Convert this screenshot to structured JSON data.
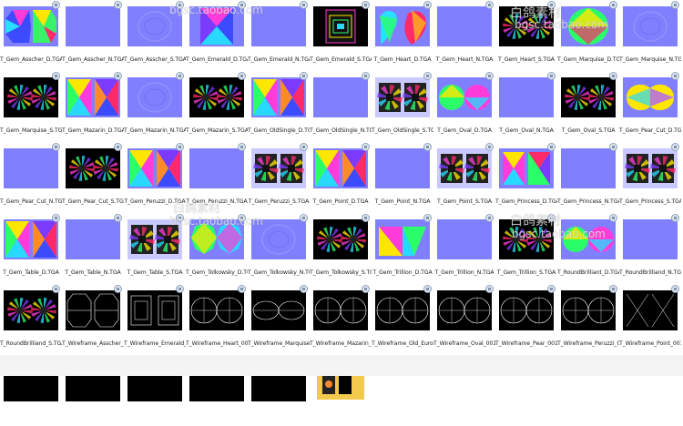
{
  "watermarks": [
    {
      "text": "bgsc.taobao.com"
    },
    {
      "text": "白鸽素材"
    },
    {
      "text": "bgsc.taobao.com"
    },
    {
      "text": "白鸽素材"
    },
    {
      "text": "bgsc.taobao.com"
    },
    {
      "text": "白鸽素材"
    },
    {
      "text": "bgsc.taobao.com"
    }
  ],
  "files": [
    {
      "name": "T_Gem_Asscher_D.TGA",
      "kind": "asscher-d"
    },
    {
      "name": "T_Gem_Asscher_N.TGA",
      "kind": "normal"
    },
    {
      "name": "T_Gem_Asscher_S.TGA",
      "kind": "normal-shape"
    },
    {
      "name": "T_Gem_Emerald_D.TGA",
      "kind": "emerald-d"
    },
    {
      "name": "T_Gem_Emerald_N.TGA",
      "kind": "normal"
    },
    {
      "name": "T_Gem_Emerald_S.TGA",
      "kind": "emerald-s"
    },
    {
      "name": "T_Gem_Heart_D.TGA",
      "kind": "heart-d"
    },
    {
      "name": "T_Gem_Heart_N.TGA",
      "kind": "normal"
    },
    {
      "name": "T_Gem_Heart_S.TGA",
      "kind": "round-s"
    },
    {
      "name": "T_Gem_Marquise_D.TGA",
      "kind": "marquise-d"
    },
    {
      "name": "T_Gem_Marquise_N.TGA",
      "kind": "normal-shape"
    },
    {
      "name": "T_Gem_Marquise_S.TGA",
      "kind": "round-s"
    },
    {
      "name": "T_Gem_Mazarin_D.TGA",
      "kind": "split-d"
    },
    {
      "name": "T_Gem_Mazarin_N.TGA",
      "kind": "normal-shape"
    },
    {
      "name": "T_Gem_Mazarin_S.TGA",
      "kind": "round-s"
    },
    {
      "name": "T_Gem_OldSingle_D.TGA",
      "kind": "split-d"
    },
    {
      "name": "T_Gem_OldSingle_N.TGA",
      "kind": "normal"
    },
    {
      "name": "T_Gem_OldSingle_S.TGA",
      "kind": "square-s"
    },
    {
      "name": "T_Gem_Oval_D.TGA",
      "kind": "oval-d"
    },
    {
      "name": "T_Gem_Oval_N.TGA",
      "kind": "normal"
    },
    {
      "name": "T_Gem_Oval_S.TGA",
      "kind": "round-s"
    },
    {
      "name": "T_Gem_Pear_Cut_D.TGA",
      "kind": "pear-d"
    },
    {
      "name": "T_Gem_Pear_Cut_N.TGA",
      "kind": "normal"
    },
    {
      "name": "T_Gem_Pear_Cut_S.TGA",
      "kind": "round-s"
    },
    {
      "name": "T_Gem_Peruzzi_D.TGA",
      "kind": "split-d"
    },
    {
      "name": "T_Gem_Peruzzi_N.TGA",
      "kind": "normal"
    },
    {
      "name": "T_Gem_Peruzzi_S.TGA",
      "kind": "square-s"
    },
    {
      "name": "T_Gem_Point_D.TGA",
      "kind": "split-d"
    },
    {
      "name": "T_Gem_Point_N.TGA",
      "kind": "normal"
    },
    {
      "name": "T_Gem_Point_S.TGA",
      "kind": "square-s"
    },
    {
      "name": "T_Gem_Princess_D.TGA",
      "kind": "princess-d"
    },
    {
      "name": "T_Gem_Princess_N.TGA",
      "kind": "normal"
    },
    {
      "name": "T_Gem_Princess_S.TGA",
      "kind": "square-s"
    },
    {
      "name": "T_Gem_Table_D.TGA",
      "kind": "split-d"
    },
    {
      "name": "T_Gem_Table_N.TGA",
      "kind": "normal"
    },
    {
      "name": "T_Gem_Table_S.TGA",
      "kind": "square-s"
    },
    {
      "name": "T_Gem_Tolkowsky_D.TGA",
      "kind": "tolk-d"
    },
    {
      "name": "T_Gem_Tolkowsky_N.TGA",
      "kind": "normal-shape"
    },
    {
      "name": "T_Gem_Tolkowsky_S.TGA",
      "kind": "round-s"
    },
    {
      "name": "T_Gem_Trillion_D.TGA",
      "kind": "trillion-d"
    },
    {
      "name": "T_Gem_Trillion_N.TGA",
      "kind": "normal"
    },
    {
      "name": "T_Gem_Trillion_S.TGA",
      "kind": "round-s"
    },
    {
      "name": "T_RoundBrilliant_D.TGA",
      "kind": "oval-d"
    },
    {
      "name": "T_RoundBrilliand_N.TGA",
      "kind": "normal"
    },
    {
      "name": "T_RoundBrilliand_S.TGA",
      "kind": "round-s"
    },
    {
      "name": "T_Wireframe_Asscher_0...",
      "kind": "wire-oct"
    },
    {
      "name": "T_Wireframe_Emerald_0...",
      "kind": "wire-rect"
    },
    {
      "name": "T_Wireframe_Heart_001...",
      "kind": "wire-round"
    },
    {
      "name": "T_Wireframe_Marquise_...",
      "kind": "wire-eye"
    },
    {
      "name": "T_Wireframe_Mazarin_0...",
      "kind": "wire-round"
    },
    {
      "name": "T_Wireframe_Old_Euro...",
      "kind": "wire-round"
    },
    {
      "name": "T_Wireframe_Oval_001...",
      "kind": "wire-round"
    },
    {
      "name": "T_Wireframe_Pear_001...",
      "kind": "wire-round"
    },
    {
      "name": "T_Wireframe_Peruzzi_001...",
      "kind": "wire-round"
    },
    {
      "name": "T_Wireframe_Point_001...",
      "kind": "wire-x"
    },
    {
      "name": "",
      "kind": "wire-partial"
    },
    {
      "name": "",
      "kind": "wire-partial"
    },
    {
      "name": "",
      "kind": "wire-partial"
    },
    {
      "name": "",
      "kind": "wire-partial"
    },
    {
      "name": "",
      "kind": "wire-partial"
    },
    {
      "name": "",
      "kind": "folder"
    }
  ]
}
